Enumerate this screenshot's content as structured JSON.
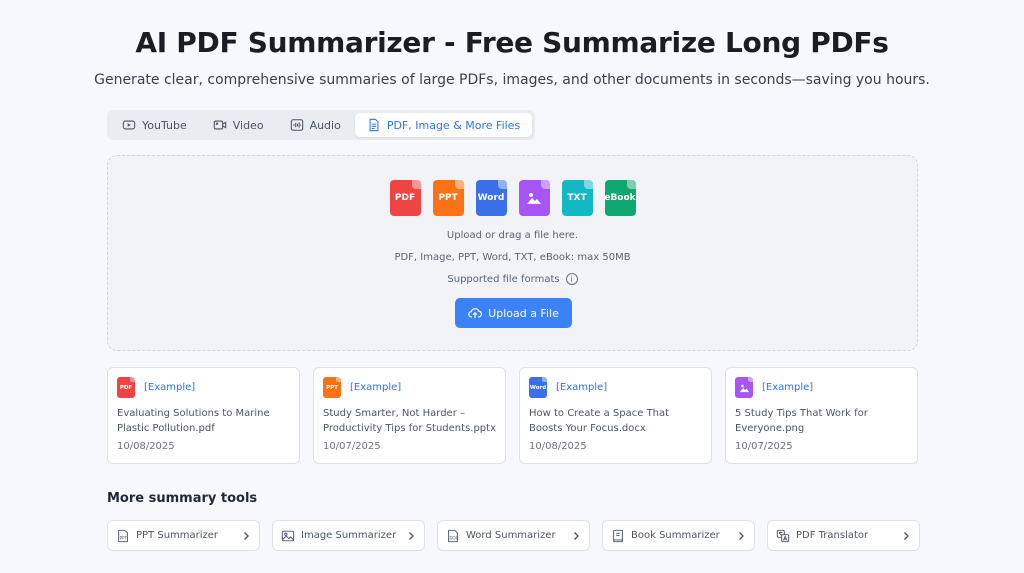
{
  "header": {
    "title": "AI PDF Summarizer - Free Summarize Long PDFs",
    "subtitle": "Generate clear, comprehensive summaries of large PDFs, images, and other documents in seconds—saving you hours."
  },
  "tabs": [
    {
      "label": "YouTube",
      "icon": "youtube-icon"
    },
    {
      "label": "Video",
      "icon": "video-icon"
    },
    {
      "label": "Audio",
      "icon": "audio-icon"
    },
    {
      "label": "PDF, Image & More Files",
      "icon": "file-icon",
      "active": true
    }
  ],
  "upload": {
    "file_types": [
      {
        "label": "PDF",
        "color": "#ef4444"
      },
      {
        "label": "PPT",
        "color": "#f97316"
      },
      {
        "label": "Word",
        "color": "#3b6fe8"
      },
      {
        "label": "",
        "icon": "image-icon",
        "color": "#a855f7"
      },
      {
        "label": "TXT",
        "color": "#14b8c4"
      },
      {
        "label": "eBook",
        "color": "#10a870"
      }
    ],
    "instruction": "Upload or drag a file here.",
    "limits": "PDF, Image, PPT, Word, TXT, eBook: max 50MB",
    "formats_label": "Supported file formats",
    "button_label": "Upload a File"
  },
  "examples": [
    {
      "tag": "[Example]",
      "type": "PDF",
      "color": "#ef4444",
      "title": "Evaluating Solutions to Marine Plastic Pollution.pdf",
      "date": "10/08/2025"
    },
    {
      "tag": "[Example]",
      "type": "PPT",
      "color": "#f97316",
      "title": "Study Smarter, Not Harder – Productivity Tips for Students.pptx",
      "date": "10/07/2025"
    },
    {
      "tag": "[Example]",
      "type": "Word",
      "color": "#3b6fe8",
      "title": "How to Create a Space That Boosts Your Focus.docx",
      "date": "10/08/2025"
    },
    {
      "tag": "[Example]",
      "type": "",
      "color": "#a855f7",
      "title": "5 Study Tips That Work for Everyone.png",
      "date": "10/07/2025"
    }
  ],
  "more_tools": {
    "title": "More summary tools",
    "items": [
      {
        "label": "PPT Summarizer",
        "icon": "ppt-icon"
      },
      {
        "label": "Image Summarizer",
        "icon": "image-icon"
      },
      {
        "label": "Word Summarizer",
        "icon": "doc-icon"
      },
      {
        "label": "Book Summarizer",
        "icon": "book-icon"
      },
      {
        "label": "PDF Translator",
        "icon": "translate-icon"
      }
    ]
  },
  "colors": {
    "accent": "#3b82f6",
    "background": "#f6f8fb"
  }
}
